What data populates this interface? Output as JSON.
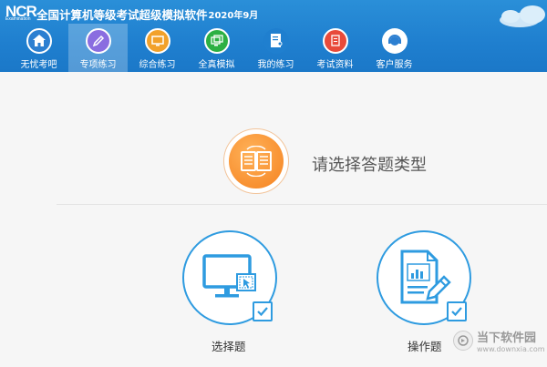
{
  "app": {
    "logo_text": "NCR",
    "logo_sub": "Examination",
    "title": "全国计算机等级考试超级模拟软件",
    "date": "2020年9月"
  },
  "nav": [
    {
      "label": "无忧考吧",
      "icon": "home-icon",
      "color": "#2c7fd1",
      "active": false
    },
    {
      "label": "专项练习",
      "icon": "pencil-icon",
      "color": "#8a6de0",
      "active": true
    },
    {
      "label": "综合练习",
      "icon": "monitor-icon",
      "color": "#f2a12a",
      "active": false
    },
    {
      "label": "全真模拟",
      "icon": "screens-icon",
      "color": "#2db043",
      "active": false
    },
    {
      "label": "我的练习",
      "icon": "user-doc-icon",
      "color": "#2c7fd1",
      "active": false
    },
    {
      "label": "考试资料",
      "icon": "document-icon",
      "color": "#e84a3a",
      "active": false
    },
    {
      "label": "客户服务",
      "icon": "headset-icon",
      "color": "#2c7fd1",
      "active": false
    }
  ],
  "main": {
    "prompt": "请选择答题类型",
    "options": [
      {
        "label": "选择题",
        "icon": "computer-select-icon"
      },
      {
        "label": "操作题",
        "icon": "document-edit-icon"
      }
    ]
  },
  "watermark": {
    "name": "当下软件园",
    "url": "www.downxia.com"
  },
  "colors": {
    "accent": "#2e9be0",
    "header_bg": "#1f7fcf",
    "orange": "#f58220"
  }
}
